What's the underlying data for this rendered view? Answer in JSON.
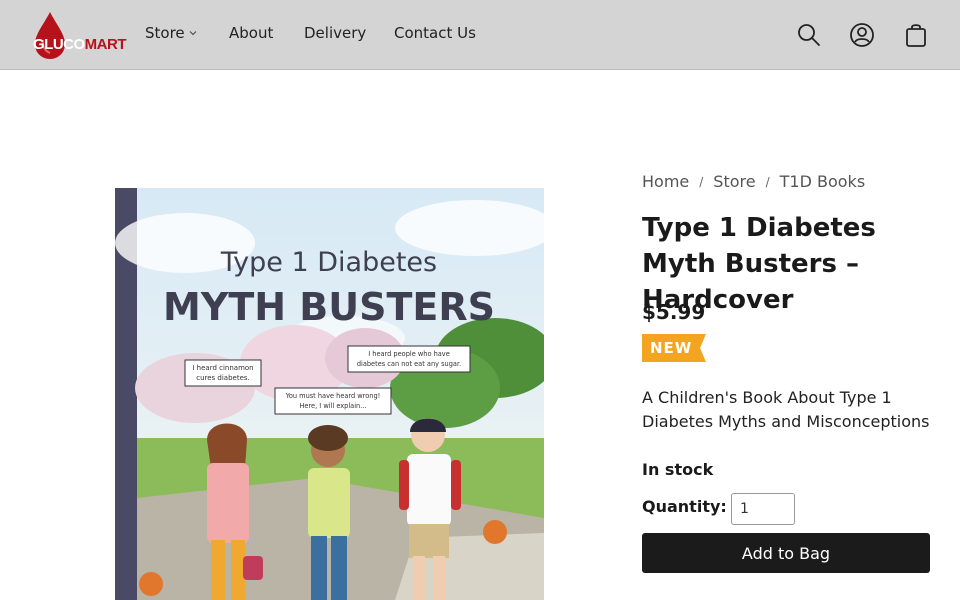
{
  "brand": {
    "logo_part1": "GLUCO",
    "logo_part2": "MART",
    "color": "#b5121b"
  },
  "nav": {
    "items": [
      {
        "label": "Store",
        "has_dropdown": true
      },
      {
        "label": "About"
      },
      {
        "label": "Delivery"
      },
      {
        "label": "Contact Us"
      }
    ]
  },
  "header_icons": [
    "search-icon",
    "account-icon",
    "shopping-bag-icon"
  ],
  "breadcrumb": [
    "Home",
    "Store",
    "T1D Books"
  ],
  "breadcrumb_separator": "/",
  "product": {
    "title": "Type 1 Diabetes Myth Busters – Hardcover",
    "price": "$5.99",
    "badge": "NEW",
    "badge_color": "#f3a521",
    "description": "A Children's Book About Type 1 Diabetes Myths and Misconceptions",
    "stock_status": "In stock",
    "quantity_label": "Quantity:",
    "quantity_value": "1",
    "add_button_label": "Add to Bag"
  },
  "cover": {
    "subtitle": "Type 1 Diabetes",
    "title": "MYTH BUSTERS",
    "bubble_left_line1": "I heard cinnamon",
    "bubble_left_line2": "cures diabetes.",
    "bubble_center_line1": "You must have heard wrong!",
    "bubble_center_line2": "Here, I will explain...",
    "bubble_right_line1": "I heard people who have",
    "bubble_right_line2": "diabetes can not eat any sugar."
  }
}
